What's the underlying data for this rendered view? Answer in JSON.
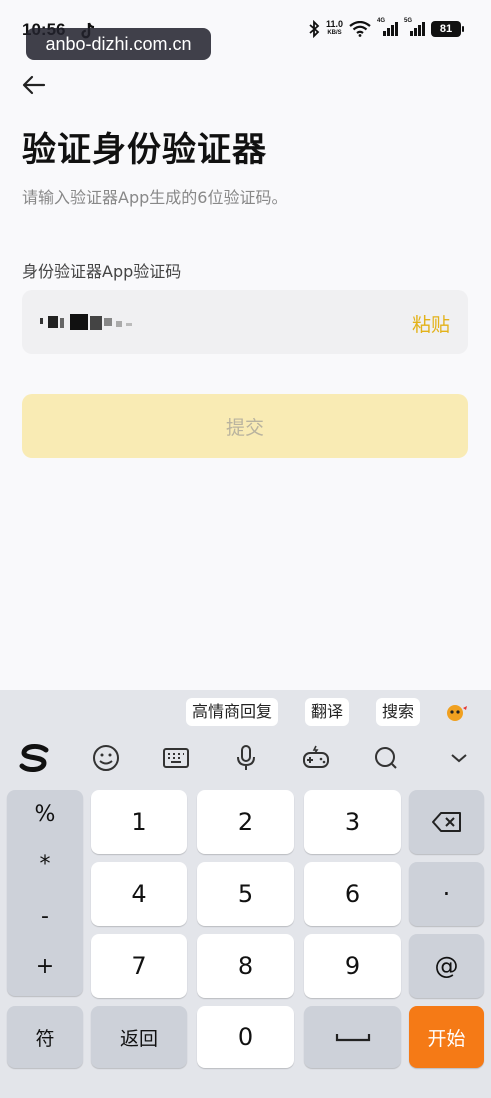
{
  "status_bar": {
    "time": "10:56",
    "watermark": "anbo-dizhi.com.cn",
    "net_speed": "11.0",
    "net_speed_unit": "KB/S",
    "signal1_label": "4G",
    "signal2_label": "5G",
    "battery": "81"
  },
  "page": {
    "title": "验证身份验证器",
    "subtitle": "请输入验证器App生成的6位验证码。",
    "field_label": "身份验证器App验证码",
    "paste_label": "粘贴",
    "submit_label": "提交"
  },
  "keyboard": {
    "suggestions": [
      "高情商回复",
      "翻译",
      "搜索"
    ],
    "symbols": [
      "%",
      "*",
      "-",
      "+"
    ],
    "digits": [
      "1",
      "2",
      "3",
      "4",
      "5",
      "6",
      "7",
      "8",
      "9",
      "0"
    ],
    "dot": "·",
    "at": "@",
    "fu_label": "符",
    "back_label": "返回",
    "start_label": "开始"
  },
  "colors": {
    "accent": "#e3b21a",
    "submit_bg": "#f9ebb4",
    "start_key": "#f57a16"
  }
}
